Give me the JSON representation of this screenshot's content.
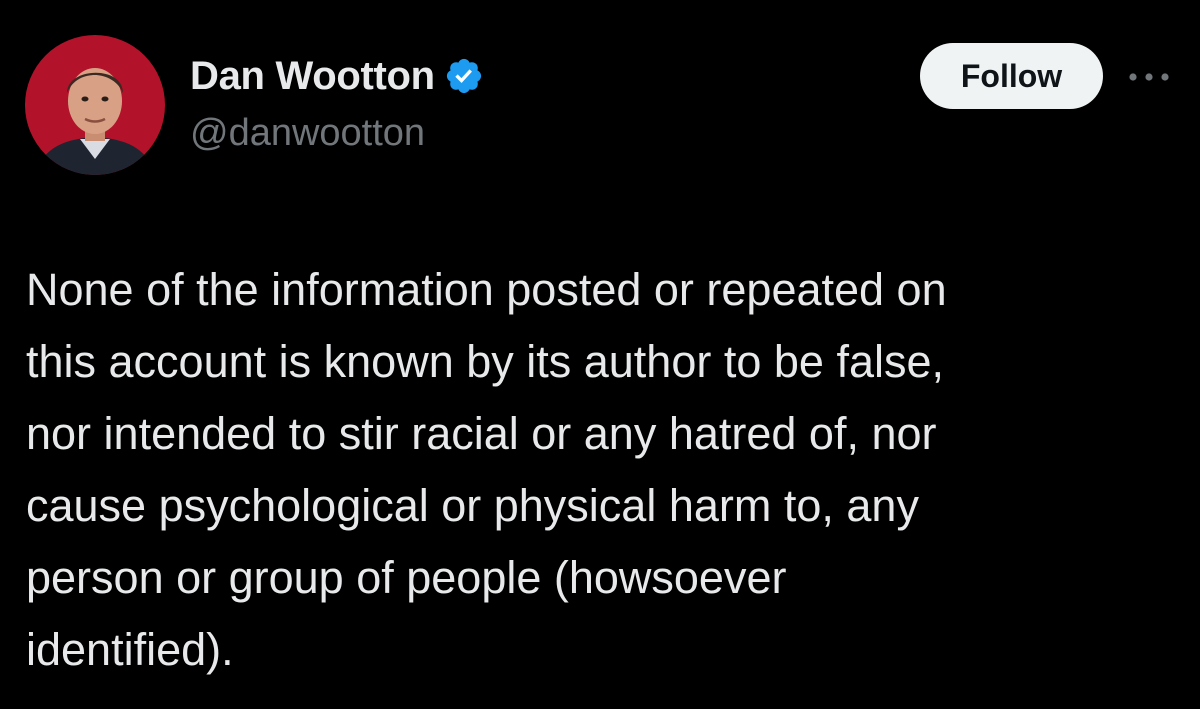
{
  "author": {
    "display_name": "Dan Wootton",
    "handle": "@danwootton",
    "verified": true,
    "avatar_icon": "profile-photo",
    "verified_icon": "verified-checkmark-icon"
  },
  "actions": {
    "follow_label": "Follow",
    "more_icon": "more-options-icon"
  },
  "tweet": {
    "lines": [
      "None of the information posted or repeated on",
      "this account is known by its author to be false,",
      "nor intended to stir racial or any hatred of, nor",
      "cause psychological or physical harm to, any",
      "person or group of people (howsoever",
      "identified)."
    ]
  },
  "colors": {
    "background": "#000000",
    "primary_text": "#e7e9ea",
    "secondary_text": "#71767b",
    "verified_blue": "#1d9bf0",
    "follow_bg": "#eff3f4",
    "avatar_bg": "#b3122b"
  }
}
